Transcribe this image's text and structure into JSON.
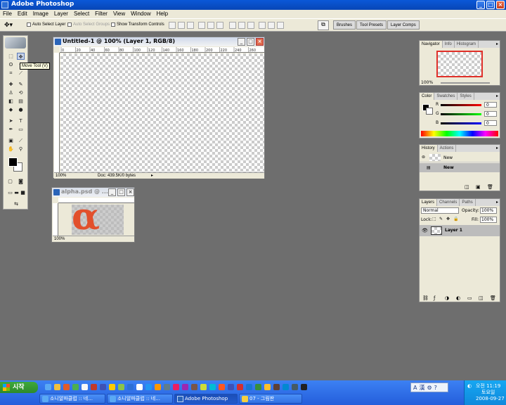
{
  "window": {
    "title": "Adobe Photoshop"
  },
  "menu": [
    "File",
    "Edit",
    "Image",
    "Layer",
    "Select",
    "Filter",
    "View",
    "Window",
    "Help"
  ],
  "options": {
    "auto_select_layer": "Auto Select Layer",
    "auto_select_groups": "Auto Select Groups",
    "show_transform": "Show Transform Controls"
  },
  "palette_well": [
    "Brushes",
    "Tool Presets",
    "Layer Comps"
  ],
  "tooltip": "Move Tool (V)",
  "doc1": {
    "title": "Untitled-1 @ 100% (Layer 1, RGB/8)",
    "ruler": [
      "0",
      "20",
      "40",
      "60",
      "80",
      "100",
      "120",
      "140",
      "160",
      "180",
      "200",
      "220",
      "240",
      "260"
    ],
    "zoom": "100%",
    "status": "Doc: 439.5K/0 bytes"
  },
  "doc2": {
    "title": "alpha.psd @ ...",
    "ruler": [
      "0",
      "20",
      "40",
      "60",
      "80",
      "100"
    ],
    "zoom": "100%",
    "glyph": "α"
  },
  "navigator": {
    "tabs": [
      "Navigator",
      "Info",
      "Histogram"
    ],
    "zoom": "100%"
  },
  "color": {
    "tabs": [
      "Color",
      "Swatches",
      "Styles"
    ],
    "channels": [
      {
        "label": "R",
        "value": "0"
      },
      {
        "label": "G",
        "value": "0"
      },
      {
        "label": "B",
        "value": "0"
      }
    ]
  },
  "history": {
    "tabs": [
      "History",
      "Actions"
    ],
    "items": [
      "New",
      "New"
    ]
  },
  "layers": {
    "tabs": [
      "Layers",
      "Channels",
      "Paths"
    ],
    "blend_mode": "Normal",
    "opacity_label": "Opacity:",
    "opacity": "100%",
    "lock_label": "Lock:",
    "fill_label": "Fill:",
    "fill": "100%",
    "layer_name": "Layer 1"
  },
  "taskbar": {
    "start": "시작",
    "buttons": [
      "소니알파클럽 :: 네...",
      "소니알파클럽 :: 네...",
      "Adobe Photoshop",
      "07 - 그림판"
    ],
    "time_line1": "오전 11:19",
    "time_line2": "토요일",
    "date": "2008-09-27"
  }
}
